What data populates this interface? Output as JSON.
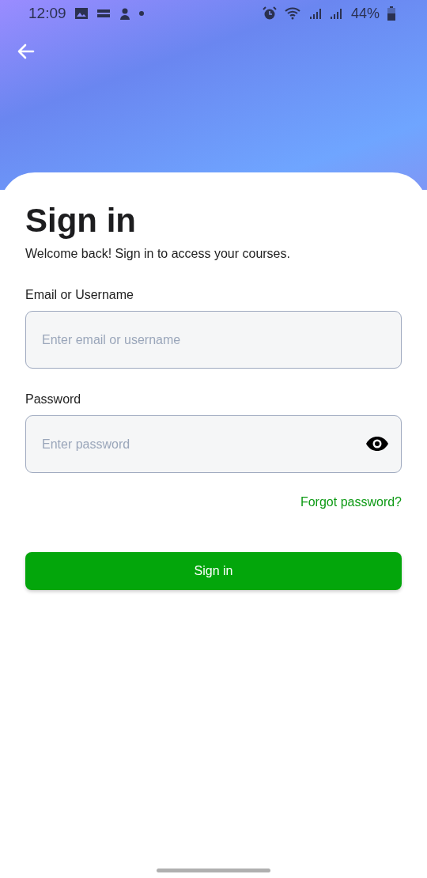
{
  "status_bar": {
    "time": "12:09",
    "battery": "44%"
  },
  "title": "Sign in",
  "subtitle": "Welcome back! Sign in to access your courses.",
  "fields": [
    {
      "label": "Email or Username",
      "placeholder": "Enter email or username",
      "kind": "text"
    },
    {
      "label": "Password",
      "placeholder": "Enter password",
      "kind": "password"
    }
  ],
  "forgot_link": "Forgot password?",
  "submit_button": "Sign in"
}
